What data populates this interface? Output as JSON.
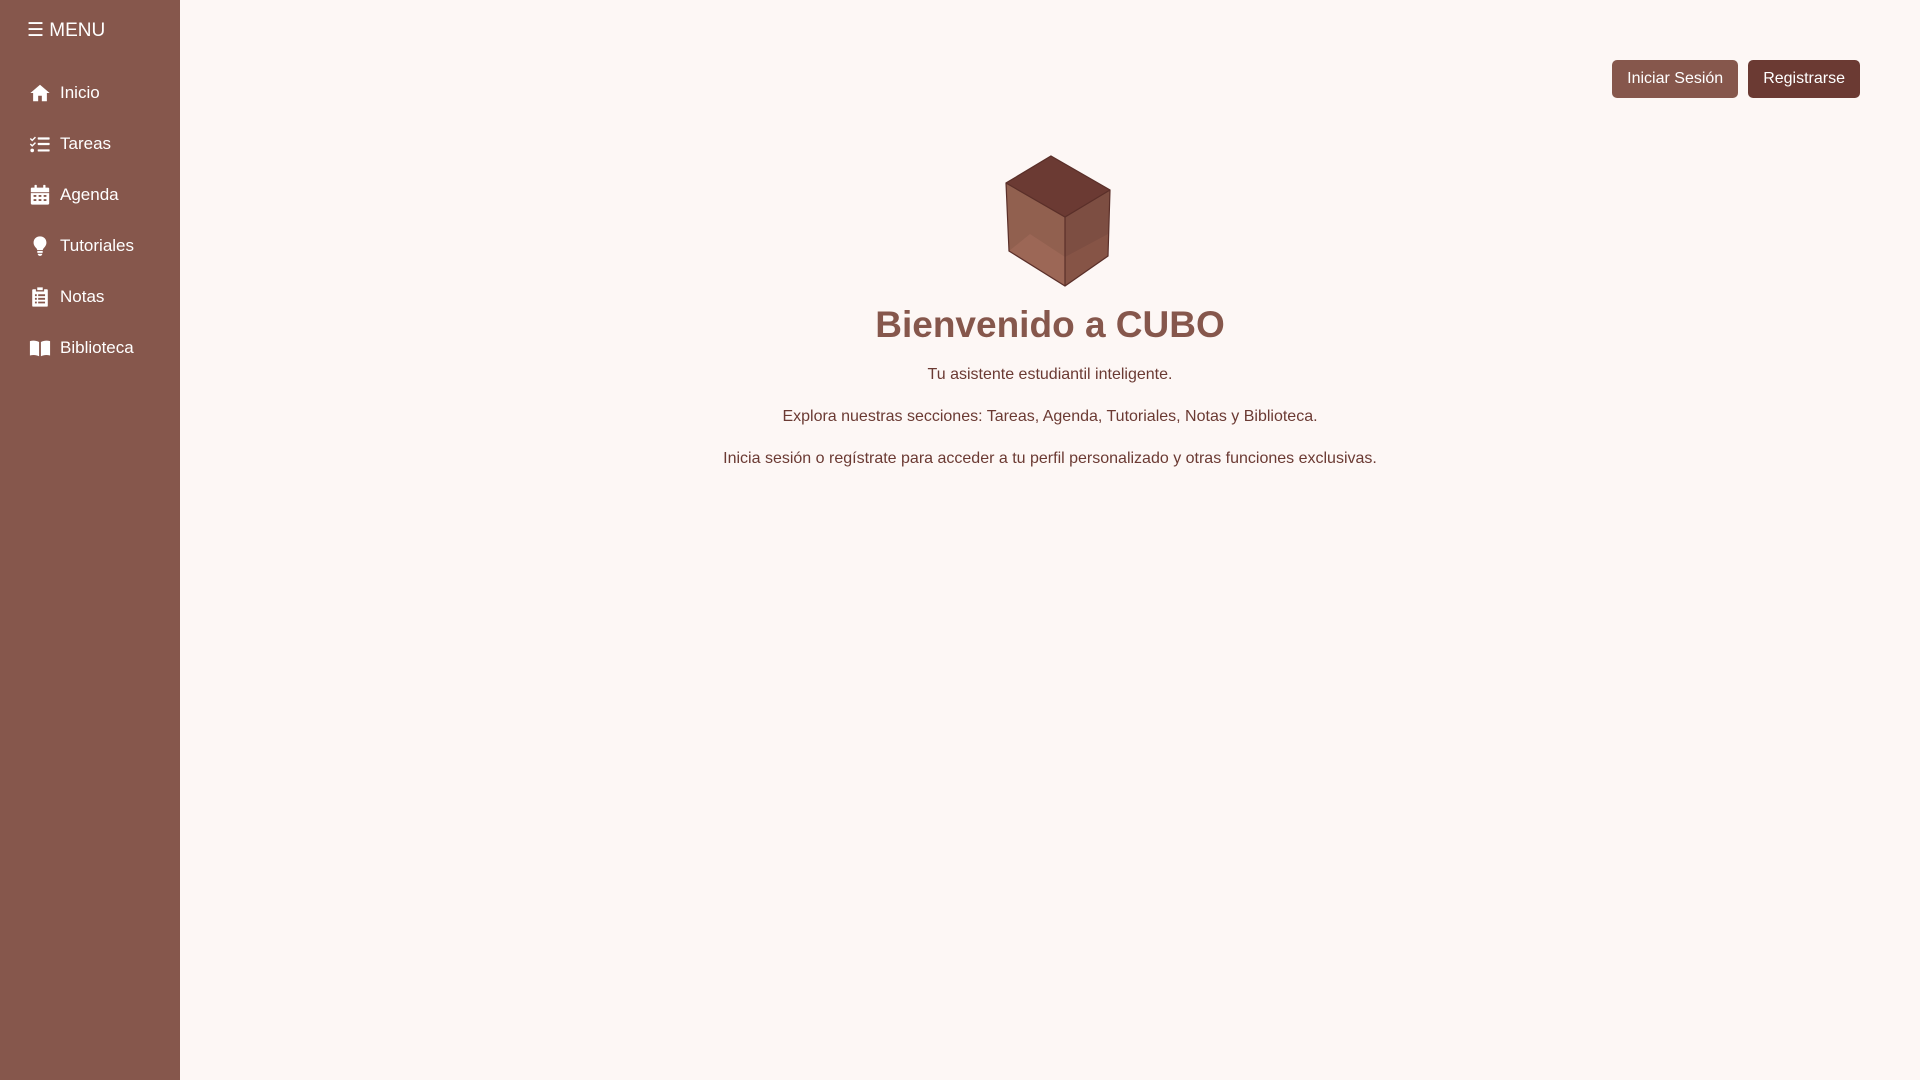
{
  "sidebar": {
    "menu_label": "☰ MENU",
    "items": [
      {
        "label": "Inicio",
        "icon": "home-icon"
      },
      {
        "label": "Tareas",
        "icon": "task-list-icon"
      },
      {
        "label": "Agenda",
        "icon": "calendar-icon"
      },
      {
        "label": "Tutoriales",
        "icon": "lightbulb-icon"
      },
      {
        "label": "Notas",
        "icon": "clipboard-icon"
      },
      {
        "label": "Biblioteca",
        "icon": "book-icon"
      }
    ]
  },
  "header": {
    "login_label": "Iniciar Sesión",
    "register_label": "Registrarse"
  },
  "hero": {
    "logo_icon": "cube-icon",
    "title": "Bienvenido a CUBO",
    "subtitle": "Tu asistente estudiantil inteligente.",
    "sections_text": "Explora nuestras secciones: Tareas, Agenda, Tutoriales, Notas y Biblioteca.",
    "cta_text": "Inicia sesión o regístrate para acceder a tu perfil personalizado y otras funciones exclusivas."
  },
  "colors": {
    "sidebar_bg": "#86574c",
    "page_bg": "#fdf7f5",
    "primary_button": "#86574c",
    "secondary_button": "#6b3a33",
    "text": "#6b3a33"
  }
}
